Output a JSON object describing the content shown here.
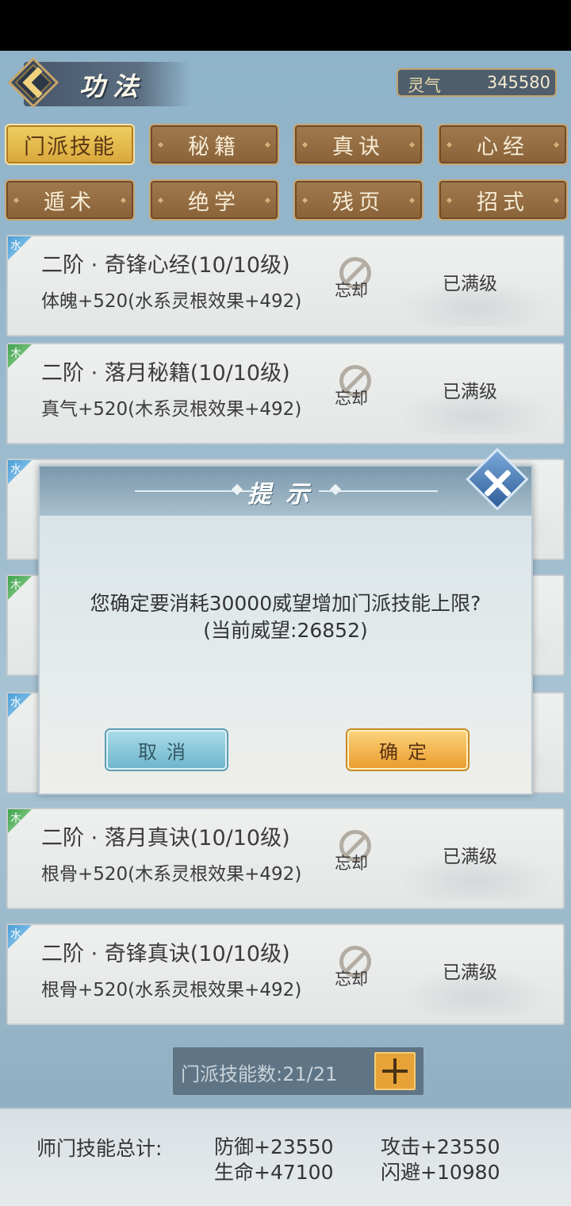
{
  "header": {
    "title": "功法",
    "currency_label": "灵气",
    "currency_value": "345580"
  },
  "tabs": [
    {
      "label": "门派技能",
      "active": true
    },
    {
      "label": "秘籍",
      "active": false
    },
    {
      "label": "真诀",
      "active": false
    },
    {
      "label": "心经",
      "active": false
    },
    {
      "label": "遁术",
      "active": false
    },
    {
      "label": "绝学",
      "active": false
    },
    {
      "label": "残页",
      "active": false
    },
    {
      "label": "招式",
      "active": false
    }
  ],
  "skills": [
    {
      "element": "水",
      "name": "二阶 · 奇锋心经(10/10级)",
      "effect": "体魄+520(水系灵根效果+492)",
      "forget_label": "忘却",
      "status": "已满级"
    },
    {
      "element": "木",
      "name": "二阶 · 落月秘籍(10/10级)",
      "effect": "真气+520(木系灵根效果+492)",
      "forget_label": "忘却",
      "status": "已满级"
    },
    {
      "element": "水",
      "name": "",
      "effect": "",
      "forget_label": "",
      "status": ""
    },
    {
      "element": "木",
      "name": "",
      "effect": "",
      "forget_label": "",
      "status": ""
    },
    {
      "element": "水",
      "name": "",
      "effect": "",
      "forget_label": "",
      "status": ""
    },
    {
      "element": "木",
      "name": "二阶 · 落月真诀(10/10级)",
      "effect": "根骨+520(木系灵根效果+492)",
      "forget_label": "忘却",
      "status": "已满级"
    },
    {
      "element": "水",
      "name": "二阶 · 奇锋真诀(10/10级)",
      "effect": "根骨+520(水系灵根效果+492)",
      "forget_label": "忘却",
      "status": "已满级"
    }
  ],
  "skill_count": {
    "label": "门派技能数:21/21"
  },
  "totals": {
    "label": "师门技能总计:",
    "defense": "防御+23550",
    "attack": "攻击+23550",
    "hp": "生命+47100",
    "dodge": "闪避+10980"
  },
  "dialog": {
    "title": "提示",
    "message_line1": "您确定要消耗30000威望增加门派技能上限?",
    "message_line2": "(当前威望:26852)",
    "cancel_label": "取消",
    "confirm_label": "确定"
  },
  "colors": {
    "tab_active": "#e8bd4e",
    "tab_inactive": "#946b40",
    "confirm_button": "#f2b04a",
    "cancel_button": "#8ccbdc"
  }
}
